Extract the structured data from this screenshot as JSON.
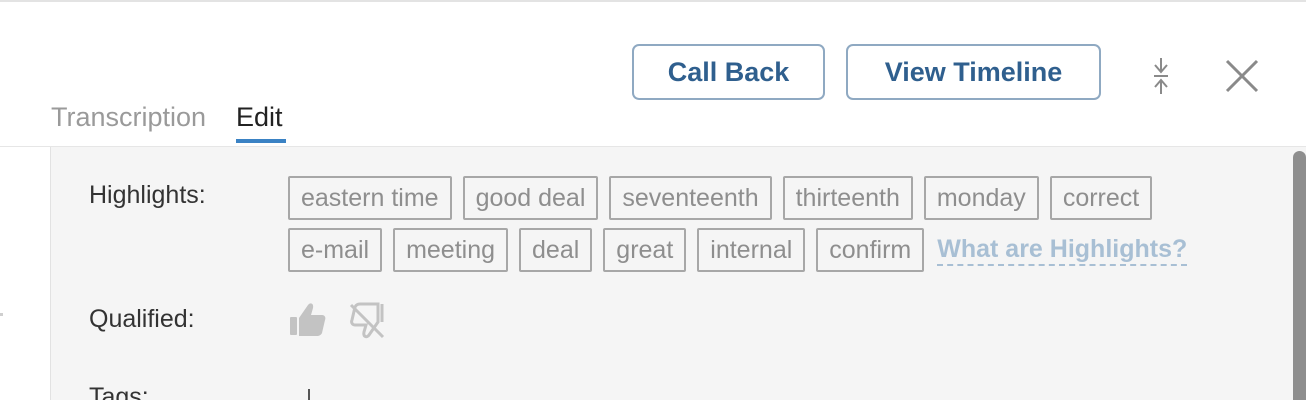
{
  "header": {
    "call_back_label": "Call Back",
    "view_timeline_label": "View Timeline",
    "collapse_icon": "collapse-icon",
    "close_icon": "close-icon"
  },
  "tabs": [
    {
      "label": "Transcription",
      "active": false
    },
    {
      "label": "Edit",
      "active": true
    }
  ],
  "details": {
    "highlights_label": "Highlights:",
    "highlights": [
      "eastern time",
      "good deal",
      "seventeenth",
      "thirteenth",
      "monday",
      "correct",
      "e-mail",
      "meeting",
      "deal",
      "great",
      "internal",
      "confirm"
    ],
    "highlights_help": "What are Highlights?",
    "qualified_label": "Qualified:",
    "qualified_icons": [
      "thumbs-up-icon",
      "thumbs-down-icon"
    ],
    "tags_label": "Tags:"
  },
  "colors": {
    "accent": "#3a82c4",
    "button_text": "#2f5f8e",
    "link": "#a8bfd4"
  }
}
